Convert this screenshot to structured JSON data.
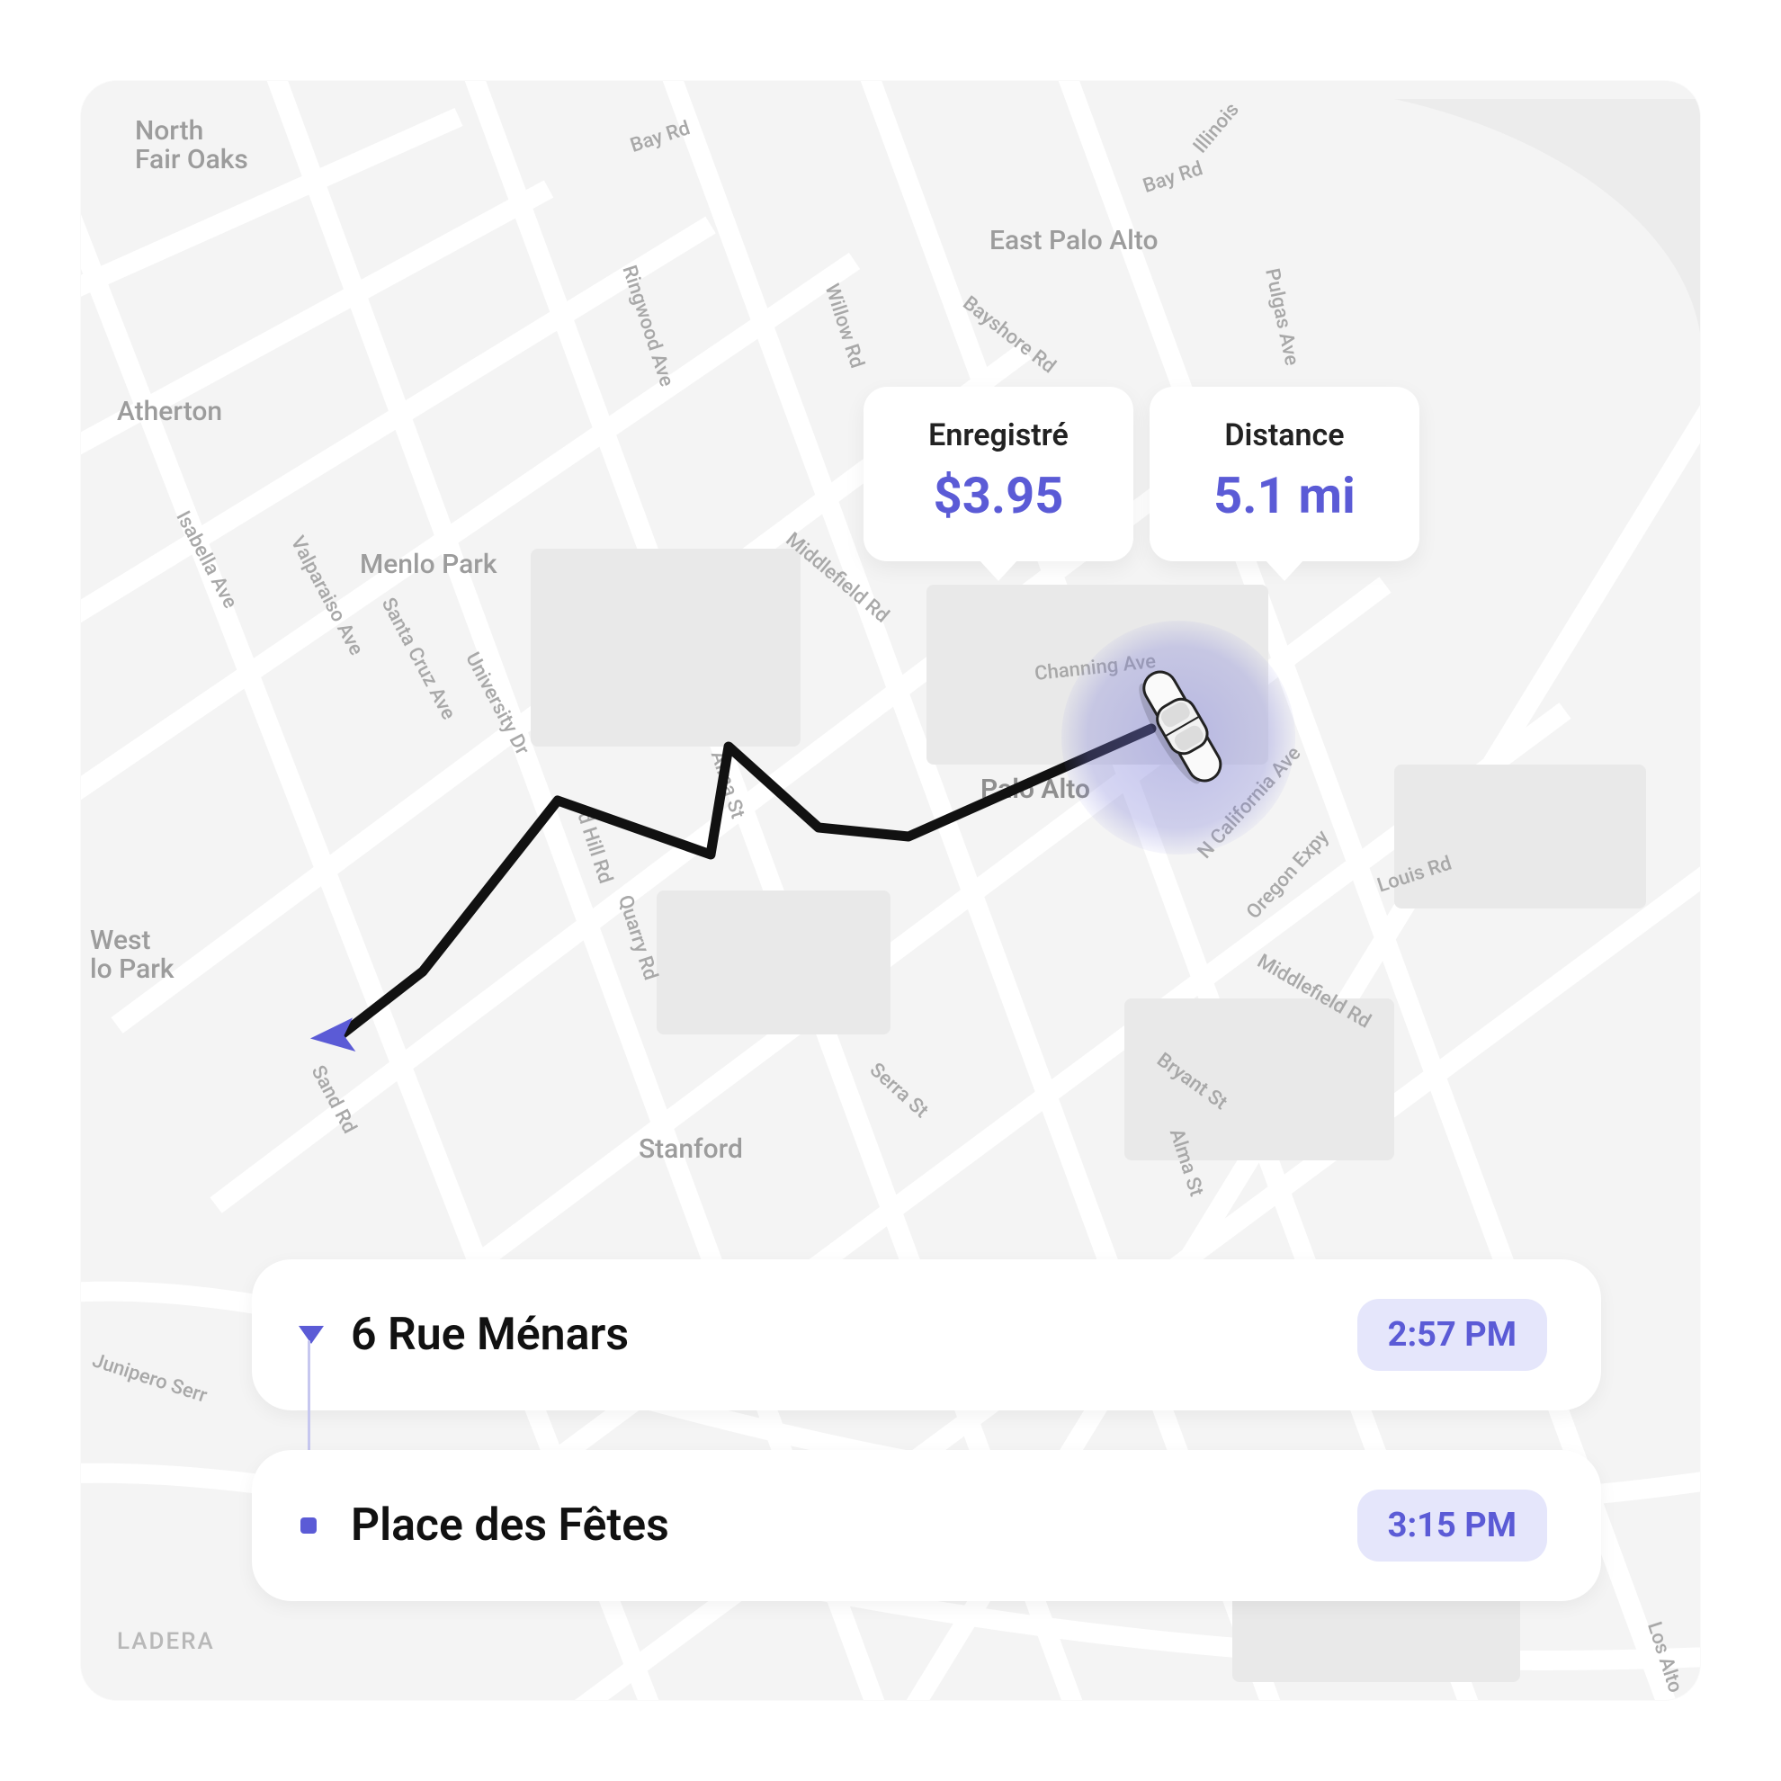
{
  "map": {
    "places": {
      "north_fair_oaks": "North\nFair Oaks",
      "atherton": "Atherton",
      "menlo_park": "Menlo Park",
      "east_palo_alto": "East Palo Alto",
      "palo_alto": "Palo Alto",
      "west_menlo_park": "West\nlo Park",
      "stanford": "Stanford",
      "ladera": "LADERA"
    },
    "roads": {
      "bay_rd_1": "Bay Rd",
      "bay_rd_2": "Bay Rd",
      "illinois": "Illinois",
      "ringwood": "Ringwood Ave",
      "willow": "Willow Rd",
      "bayshore": "Bayshore Rd",
      "pulgas": "Pulgas Ave",
      "isabella": "Isabella Ave",
      "valparaiso": "Valparaiso Ave",
      "santa_cruz": "Santa Cruz Ave",
      "university": "University Dr",
      "middlefield": "Middlefield Rd",
      "d_hill": "d Hill Rd",
      "alma": "Alma St",
      "channing": "Channing Ave",
      "quarry": "Quarry Rd",
      "n_california": "N California Ave",
      "oregon": "Oregon Expy",
      "louis": "Louis Rd",
      "middlefield2": "Middlefield Rd",
      "bryant": "Bryant St",
      "alma2": "Alma St",
      "sand": "Sand Rd",
      "junipero": "Junipero Serr",
      "serra": "Serra St",
      "los_alto": "Los Alto"
    }
  },
  "stats": {
    "saved_label": "Enregistré",
    "saved_value": "$3.95",
    "distance_label": "Distance",
    "distance_value": "5.1 mi"
  },
  "stops": {
    "start_name": "6 Rue Ménars",
    "start_time": "2:57 PM",
    "end_name": "Place des Fêtes",
    "end_time": "3:15 PM"
  },
  "colors": {
    "accent": "#5b5bd6"
  }
}
